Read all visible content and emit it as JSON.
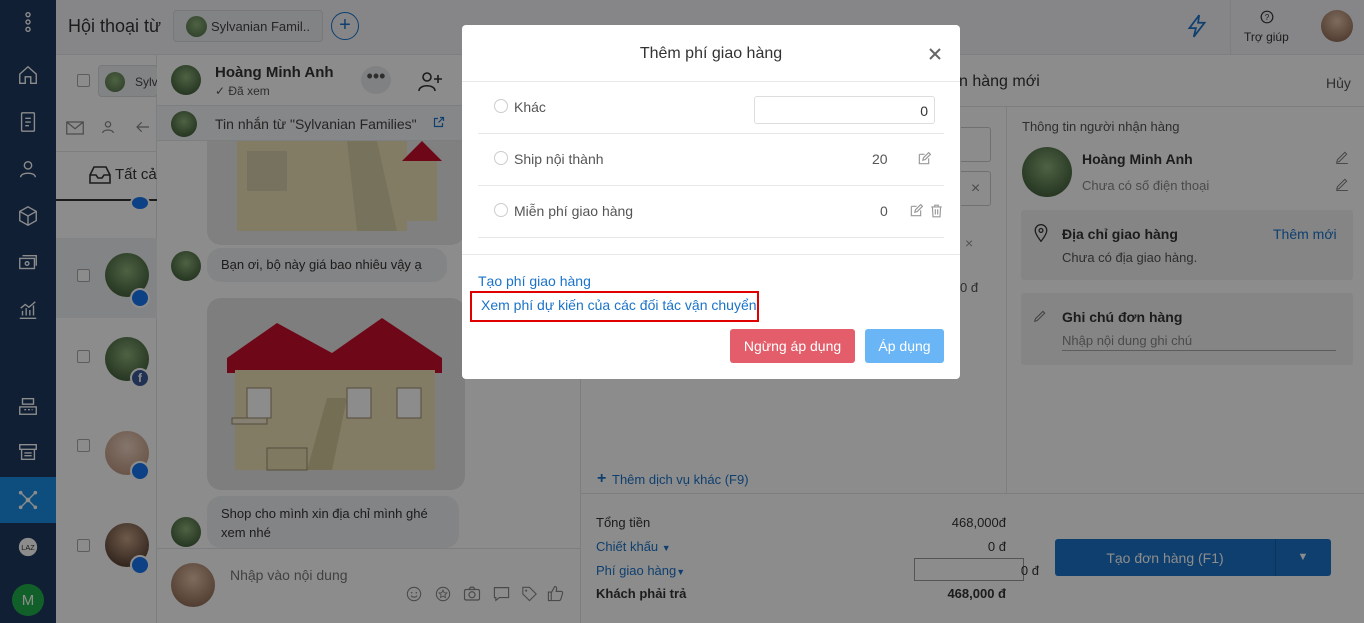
{
  "header": {
    "title": "Hội thoại từ",
    "page_tab": "Sylvanian Famil..",
    "help_label": "Trợ giúp"
  },
  "conv_list": {
    "page_chip": "Sylv",
    "tab_all": "Tất cả"
  },
  "chat": {
    "contact_name": "Hoàng Minh Anh",
    "seen_status": "✓ Đã xem",
    "source_label": "Tin nhắn từ \"Sylvanian Families\"",
    "messages": [
      "Bạn ơi, bộ này giá bao nhiêu vậy ạ",
      "Shop cho mình xin địa chỉ mình ghé xem nhé"
    ],
    "input_placeholder": "Nhập vào nội dung"
  },
  "order": {
    "title_fragment": "n hàng mới",
    "cancel_label": "Hủy",
    "recipient_header": "Thông tin người nhận hàng",
    "recipient_name": "Hoàng Minh Anh",
    "recipient_phone": "Chưa có số điện thoại",
    "address_label": "Địa chỉ giao hàng",
    "address_add": "Thêm mới",
    "address_value": "Chưa có địa giao hàng.",
    "note_label": "Ghi chú đơn hàng",
    "note_placeholder": "Nhập nội dung ghi chú",
    "price_fragment": "0 đ",
    "add_service": "Thêm dịch vụ khác (F9)",
    "total_label": "Tổng tiền",
    "total_value": "468,000đ",
    "discount_label": "Chiết khấu",
    "discount_value": "0 đ",
    "shipping_label": "Phí giao hàng",
    "shipping_value": "0 đ",
    "payable_label": "Khách phải trả",
    "payable_value": "468,000 đ",
    "create_button": "Tạo đơn hàng (F1)"
  },
  "modal": {
    "title": "Thêm phí giao hàng",
    "options": [
      {
        "label": "Khác",
        "value": "0"
      },
      {
        "label": "Ship nội thành",
        "value": "20"
      },
      {
        "label": "Miễn phí giao hàng",
        "value": "0"
      }
    ],
    "create_fee_link": "Tạo phí giao hàng",
    "view_partner_fee_link": "Xem phí dự kiến của các đối tác vận chuyển",
    "stop_button": "Ngừng áp dụng",
    "apply_button": "Áp dụng"
  },
  "user_badge": "M",
  "colors": {
    "nav_bg": "#1e3a5f",
    "nav_active": "#1a8ee6",
    "primary": "#1a73c9",
    "stop_button": "#e35d6a",
    "apply_button": "#69b5f5",
    "highlight_box": "#e00000",
    "messenger": "#1877f2",
    "user_badge": "#21b04b"
  },
  "icons": [
    "menu-dots-icon",
    "home-icon",
    "document-icon",
    "user-icon",
    "box-icon",
    "money-icon",
    "chart-icon",
    "cashier-icon",
    "store-icon",
    "network-icon",
    "lazada-icon",
    "lightning-icon",
    "help-icon",
    "plus-icon",
    "close-icon",
    "edit-icon",
    "trash-icon",
    "mail-icon",
    "inbox-icon",
    "messenger-icon",
    "facebook-icon",
    "add-user-icon",
    "external-link-icon",
    "emoji-icon",
    "star-icon",
    "camera-icon",
    "chat-icon",
    "tag-icon",
    "like-icon",
    "location-icon",
    "pencil-icon",
    "caret-down-icon"
  ]
}
